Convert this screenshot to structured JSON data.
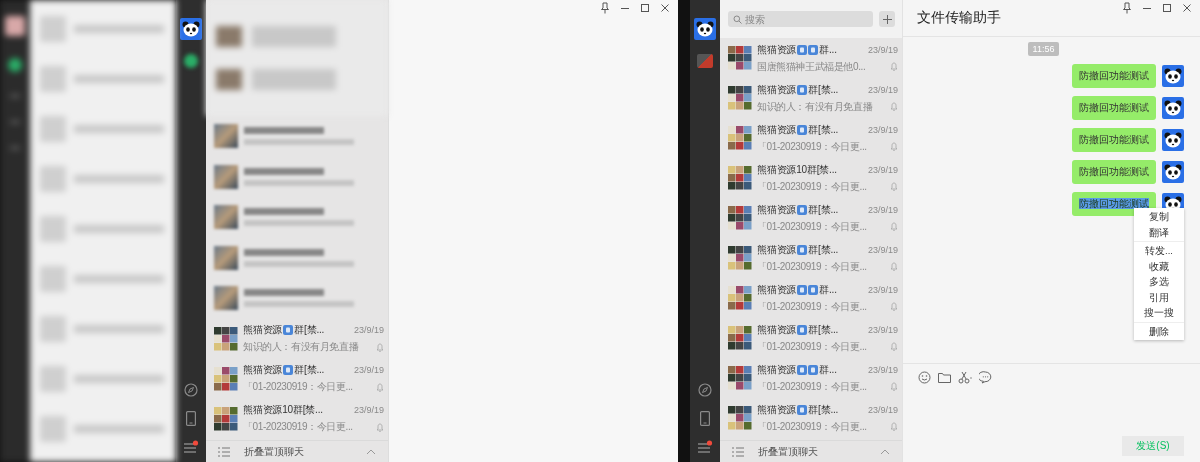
{
  "left_window": {
    "chats": [
      {
        "kind": "blurred"
      },
      {
        "kind": "blurred"
      },
      {
        "kind": "blurred"
      },
      {
        "kind": "blurred"
      },
      {
        "kind": "blurred"
      },
      {
        "kind": "chat",
        "name": [
          {
            "kind": "text",
            "text": "熊猫资源"
          },
          {
            "kind": "keycap"
          },
          {
            "kind": "text",
            "text": "群[禁..."
          }
        ],
        "time": "23/9/19",
        "preview": "知识的人：有没有月免直播"
      },
      {
        "kind": "chat",
        "name": [
          {
            "kind": "text",
            "text": "熊猫资源"
          },
          {
            "kind": "keycap"
          },
          {
            "kind": "text",
            "text": "群[禁..."
          }
        ],
        "time": "23/9/19",
        "preview": "「01-20230919：今日更..."
      },
      {
        "kind": "chat",
        "name": [
          {
            "kind": "text",
            "text": "熊猫资源10群[禁..."
          }
        ],
        "time": "23/9/19",
        "preview": "「01-20230919：今日更..."
      }
    ],
    "footer": "折叠置顶聊天"
  },
  "right_window": {
    "search": {
      "placeholder": "搜索"
    },
    "chats": [
      {
        "kind": "chat",
        "name": [
          {
            "kind": "text",
            "text": "熊猫资源"
          },
          {
            "kind": "keycap"
          },
          {
            "kind": "keycap"
          },
          {
            "kind": "text",
            "text": "群..."
          }
        ],
        "time": "23/9/19",
        "preview": "国唐熊猫神王武福是他0..."
      },
      {
        "kind": "chat",
        "name": [
          {
            "kind": "text",
            "text": "熊猫资源"
          },
          {
            "kind": "keycap"
          },
          {
            "kind": "text",
            "text": "群[禁..."
          }
        ],
        "time": "23/9/19",
        "preview": "知识的人：有没有月免直播"
      },
      {
        "kind": "chat",
        "name": [
          {
            "kind": "text",
            "text": "熊猫资源"
          },
          {
            "kind": "keycap"
          },
          {
            "kind": "text",
            "text": "群[禁..."
          }
        ],
        "time": "23/9/19",
        "preview": "「01-20230919：今日更..."
      },
      {
        "kind": "chat",
        "name": [
          {
            "kind": "text",
            "text": "熊猫资源10群[禁..."
          }
        ],
        "time": "23/9/19",
        "preview": "「01-20230919：今日更..."
      },
      {
        "kind": "chat",
        "name": [
          {
            "kind": "text",
            "text": "熊猫资源"
          },
          {
            "kind": "keycap"
          },
          {
            "kind": "text",
            "text": "群[禁..."
          }
        ],
        "time": "23/9/19",
        "preview": "「01-20230919：今日更..."
      },
      {
        "kind": "chat",
        "name": [
          {
            "kind": "text",
            "text": "熊猫资源"
          },
          {
            "kind": "keycap"
          },
          {
            "kind": "text",
            "text": "群[禁..."
          }
        ],
        "time": "23/9/19",
        "preview": "「01-20230919：今日更..."
      },
      {
        "kind": "chat",
        "name": [
          {
            "kind": "text",
            "text": "熊猫资源"
          },
          {
            "kind": "keycap"
          },
          {
            "kind": "keycap"
          },
          {
            "kind": "text",
            "text": "群..."
          }
        ],
        "time": "23/9/19",
        "preview": "「01-20230919：今日更..."
      },
      {
        "kind": "chat",
        "name": [
          {
            "kind": "text",
            "text": "熊猫资源"
          },
          {
            "kind": "keycap"
          },
          {
            "kind": "text",
            "text": "群[禁..."
          }
        ],
        "time": "23/9/19",
        "preview": "「01-20230919：今日更..."
      },
      {
        "kind": "chat",
        "name": [
          {
            "kind": "text",
            "text": "熊猫资源"
          },
          {
            "kind": "keycap"
          },
          {
            "kind": "keycap"
          },
          {
            "kind": "text",
            "text": "群..."
          }
        ],
        "time": "23/9/19",
        "preview": "「01-20230919：今日更..."
      },
      {
        "kind": "chat",
        "name": [
          {
            "kind": "text",
            "text": "熊猫资源"
          },
          {
            "kind": "keycap"
          },
          {
            "kind": "text",
            "text": "群[禁..."
          }
        ],
        "time": "23/9/19",
        "preview": "「01-20230919：今日更..."
      }
    ],
    "footer": "折叠置顶聊天",
    "chat": {
      "title": "文件传输助手",
      "time": "11:56",
      "messages": [
        {
          "text": "防撤回功能测试",
          "selected": false
        },
        {
          "text": "防撤回功能测试",
          "selected": false
        },
        {
          "text": "防撤回功能测试",
          "selected": false
        },
        {
          "text": "防撤回功能测试",
          "selected": false
        },
        {
          "text": "防撤回功能测试",
          "selected": true
        }
      ],
      "context_menu": [
        {
          "kind": "item",
          "label": "复制"
        },
        {
          "kind": "item",
          "label": "翻译"
        },
        {
          "kind": "separator"
        },
        {
          "kind": "item",
          "label": "转发..."
        },
        {
          "kind": "item",
          "label": "收藏"
        },
        {
          "kind": "item",
          "label": "多选"
        },
        {
          "kind": "item",
          "label": "引用"
        },
        {
          "kind": "item",
          "label": "搜一搜"
        },
        {
          "kind": "separator"
        },
        {
          "kind": "item",
          "label": "删除"
        }
      ],
      "send_button": "发送(S)"
    }
  }
}
